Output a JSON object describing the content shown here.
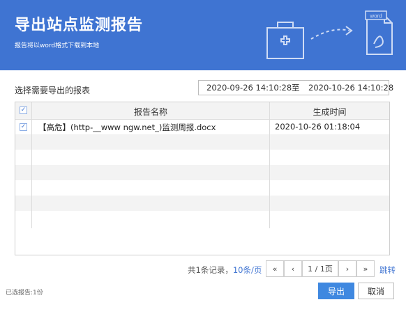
{
  "header": {
    "title": "导出站点监测报告",
    "subtitle": "报告将以word格式下载到本地",
    "illustration_word_label": "word"
  },
  "filter": {
    "label": "选择需要导出的报表",
    "date_start": "2020-09-26 14:10:28",
    "date_separator": "至",
    "date_end": "2020-10-26 14:10:28"
  },
  "table": {
    "headers": {
      "name": "报告名称",
      "time": "生成时间"
    },
    "rows": [
      {
        "name": "【高危】(http-__www          ngw.net_)监测周报.docx",
        "time": "2020-10-26 01:18:04",
        "checked": true
      }
    ]
  },
  "pager": {
    "total_text": "共1条记录，",
    "per_page": "10条/页",
    "first": "«",
    "prev": "‹",
    "page": "1 / 1页",
    "next": "›",
    "last": "»",
    "jump": "跳转"
  },
  "footer": {
    "selected_text": "已选报告:1份",
    "export_label": "导出",
    "cancel_label": "取消"
  },
  "colors": {
    "header_bg": "#3f74d2",
    "primary_button": "#3f88e0",
    "link": "#3f74d2"
  }
}
